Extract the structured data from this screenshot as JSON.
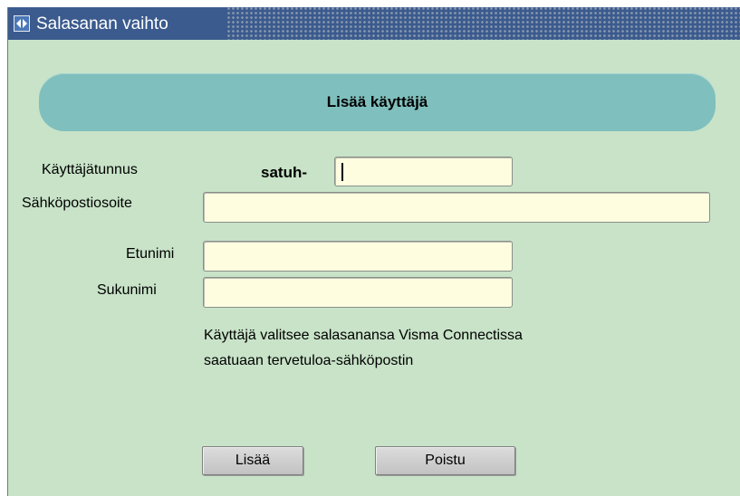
{
  "window": {
    "title": "Salasanan vaihto",
    "icon": "app-window-icon"
  },
  "header": {
    "title": "Lisää käyttäjä"
  },
  "form": {
    "username": {
      "label": "Käyttäjätunnus",
      "prefix": "satuh-",
      "value": ""
    },
    "email": {
      "label": "Sähköpostiosoite",
      "value": ""
    },
    "firstname": {
      "label": "Etunimi",
      "value": ""
    },
    "lastname": {
      "label": "Sukunimi",
      "value": ""
    }
  },
  "info": {
    "line1": "Käyttäjä valitsee salasanansa Visma Connectissa",
    "line2": "saatuaan tervetuloa-sähköpostin"
  },
  "buttons": {
    "add_label": "Lisää",
    "exit_label": "Poistu"
  },
  "colors": {
    "titlebar": "#3b5b8e",
    "background": "#c8e3c8",
    "header_pill": "#7fbfbd",
    "field_background": "#fffde0",
    "button": "#cfcfcf"
  }
}
